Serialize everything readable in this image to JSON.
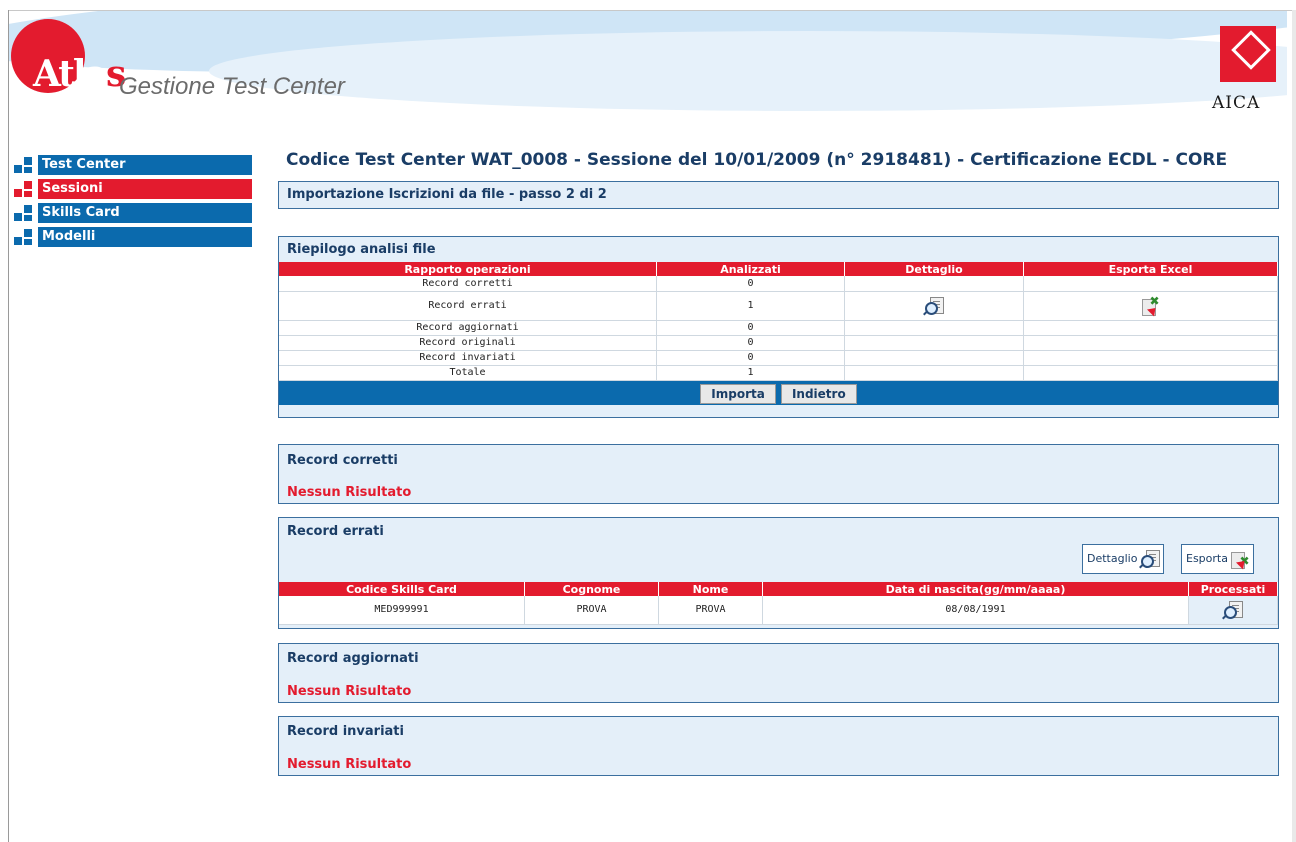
{
  "header": {
    "logo_word_main": "Atla",
    "logo_word_end": "s",
    "subtitle": "Gestione Test Center",
    "aica_label": "AICA"
  },
  "sidebar": {
    "items": [
      {
        "label": "Test Center",
        "active": false
      },
      {
        "label": "Sessioni",
        "active": true
      },
      {
        "label": "Skills Card",
        "active": false
      },
      {
        "label": "Modelli",
        "active": false
      }
    ]
  },
  "main": {
    "title": "Codice Test Center WAT_0008 - Sessione del 10/01/2009 (n° 2918481) - Certificazione ECDL - CORE",
    "step": "Importazione Iscrizioni da file - passo 2 di 2",
    "riepilogo": {
      "title": "Riepilogo analisi file",
      "headers": [
        "Rapporto operazioni",
        "Analizzati",
        "Dettaglio",
        "Esporta Excel"
      ],
      "rows": [
        {
          "label": "Record corretti",
          "value": "0"
        },
        {
          "label": "Record errati",
          "value": "1"
        },
        {
          "label": "Record aggiornati",
          "value": "0"
        },
        {
          "label": "Record originali",
          "value": "0"
        },
        {
          "label": "Record invariati",
          "value": "0"
        },
        {
          "label": "Totale",
          "value": "1"
        }
      ],
      "importa_label": "Importa",
      "indietro_label": "Indietro"
    },
    "corretti": {
      "title": "Record corretti",
      "empty": "Nessun Risultato"
    },
    "errati": {
      "title": "Record errati",
      "dettaglio_label": "Dettaglio",
      "esporta_label": "Esporta",
      "headers": [
        "Codice Skills Card",
        "Cognome",
        "Nome",
        "Data di nascita(gg/mm/aaaa)",
        "Processati"
      ],
      "rows": [
        {
          "code": "MED999991",
          "cognome": "PROVA",
          "nome": "PROVA",
          "nascita": "08/08/1991"
        }
      ]
    },
    "aggiornati": {
      "title": "Record aggiornati",
      "empty": "Nessun Risultato"
    },
    "invariati": {
      "title": "Record invariati",
      "empty": "Nessun Risultato"
    }
  },
  "colors": {
    "brand_red": "#e31b2e",
    "brand_blue": "#0b6aad",
    "panel_bg": "#e4eff9",
    "title_text": "#1a3d66"
  }
}
